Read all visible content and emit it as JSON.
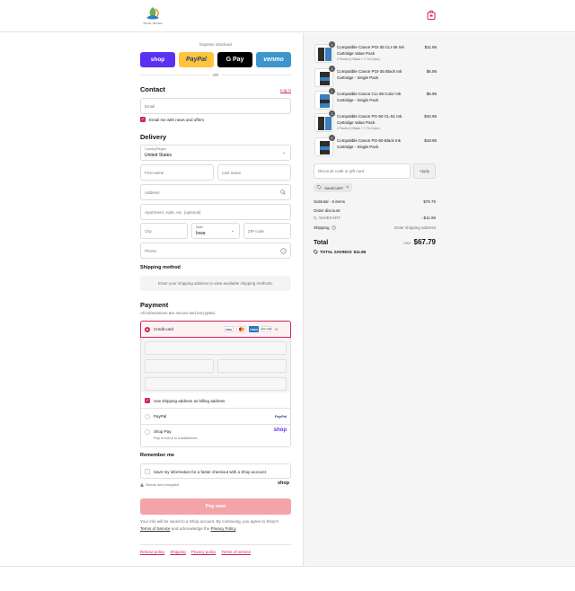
{
  "store": {
    "name": "TRUE IMAGE"
  },
  "express": {
    "title": "Express checkout",
    "shop_label": "shop",
    "paypal_label": "PayPal",
    "gpay_label": "G Pay",
    "venmo_label": "venmo",
    "or_label": "OR"
  },
  "contact": {
    "heading": "Contact",
    "login_link": "Log in",
    "email_placeholder": "Email",
    "newsletter_label": "Email me with news and offers"
  },
  "delivery": {
    "heading": "Delivery",
    "country_label": "Country/Region",
    "country_value": "United States",
    "first_name_placeholder": "First name",
    "last_name_placeholder": "Last name",
    "address_placeholder": "Address",
    "apartment_placeholder": "Apartment, suite, etc. (optional)",
    "city_placeholder": "City",
    "state_label": "State",
    "state_value": "Iowa",
    "zip_placeholder": "ZIP code",
    "phone_placeholder": "Phone"
  },
  "shipping_method": {
    "heading": "Shipping method",
    "notice": "Enter your shipping address to view available shipping methods."
  },
  "payment": {
    "heading": "Payment",
    "subtitle": "All transactions are secure and encrypted.",
    "credit_card_label": "Credit card",
    "card_brands": [
      "VISA",
      "MC",
      "AMEX",
      "DISCOVER"
    ],
    "more_cards": "+5",
    "billing_label": "Use shipping address as billing address",
    "paypal_label": "PayPal",
    "paypal_logo": "PayPal",
    "shoppay_label": "Shop Pay",
    "shoppay_sub": "Pay in full or in installments",
    "shoppay_logo": "shop"
  },
  "remember": {
    "heading": "Remember me",
    "save_label": "Save my information for a faster checkout with a Shop account",
    "secure_label": "Secure and encrypted",
    "shop_logo": "shop"
  },
  "pay_now_label": "Pay now",
  "legal": {
    "line1": "Your info will be saved to a Shop account. By continuing, you agree to Shop's",
    "terms_link": "Terms of Service",
    "line2_mid": " and acknowledge the ",
    "privacy_link": "Privacy Policy",
    "line2_end": "."
  },
  "footer_links": [
    "Refund policy",
    "Shipping",
    "Privacy policy",
    "Terms of service"
  ],
  "cart": {
    "items": [
      {
        "qty": "1",
        "name": "Compatible Canon PGI-35 CLI-36 Ink Cartridge Value Pack",
        "sub": "2 Packs (1 Black + 1 Tri-Color)",
        "price": "$11.95"
      },
      {
        "qty": "1",
        "name": "Compatible Canon PGI-35 Black Ink Cartridge - Single Pack",
        "sub": "",
        "price": "$6.95"
      },
      {
        "qty": "1",
        "name": "Compatible Canon CLI-36 Color Ink Cartridge - Single Pack",
        "sub": "",
        "price": "$6.95"
      },
      {
        "qty": "1",
        "name": "Compatible Canon PG-50 CL-51 Ink Cartridge Value Pack",
        "sub": "2 Packs (1 Black + 1 Tri-Color)",
        "price": "$34.95"
      },
      {
        "qty": "1",
        "name": "Compatible Canon PG-50 Black Ink Cartridge - Single Pack",
        "sub": "",
        "price": "$18.95"
      }
    ],
    "discount_placeholder": "Discount code or gift card",
    "apply_label": "Apply",
    "applied_code": "SAVECART",
    "subtotal_label": "Subtotal · 5 items",
    "subtotal_value": "$79.75",
    "order_discount_label": "Order discount",
    "discount_code": "SAVECART",
    "discount_value": "- $11.96",
    "shipping_label": "Shipping",
    "shipping_value": "Enter shipping address",
    "total_label": "Total",
    "currency": "USD",
    "total_value": "$67.79",
    "savings_label": "TOTAL SAVINGS",
    "savings_value": "$11.96"
  },
  "colors": {
    "accent": "#d1245a",
    "shop": "#5a31f4",
    "paypal": "#ffc439",
    "venmo": "#3d95ce",
    "pay_now": "#f4a3a8"
  }
}
